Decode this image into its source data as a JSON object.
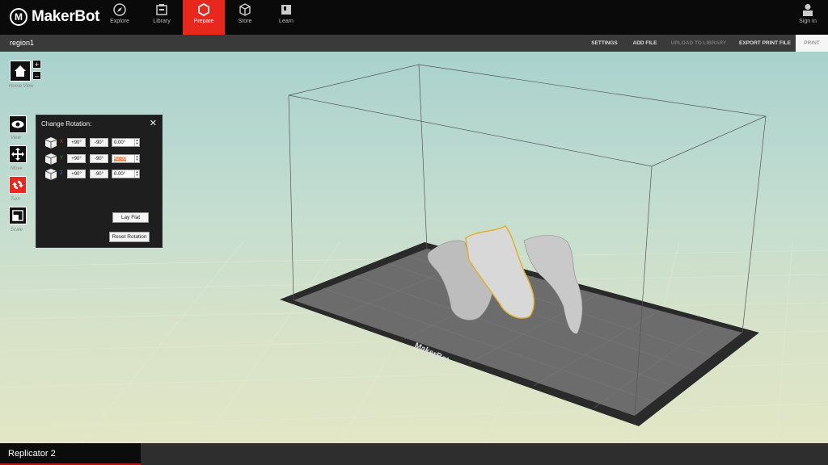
{
  "app": {
    "brand": "MakerBot"
  },
  "nav": {
    "tabs": [
      {
        "label": "Explore",
        "icon": "compass-icon",
        "active": false
      },
      {
        "label": "Library",
        "icon": "library-icon",
        "active": false
      },
      {
        "label": "Prepare",
        "icon": "prepare-cube-icon",
        "active": true
      },
      {
        "label": "Store",
        "icon": "store-cube-icon",
        "active": false
      },
      {
        "label": "Learn",
        "icon": "learn-icon",
        "active": false
      }
    ],
    "signin_label": "Sign In"
  },
  "file": {
    "name": "region1"
  },
  "actions": {
    "settings": "SETTINGS",
    "add_file": "ADD FILE",
    "upload": "UPLOAD TO LIBRARY",
    "export": "EXPORT PRINT FILE",
    "print": "PRINT"
  },
  "tools": {
    "home_view": "Home View",
    "view": "View",
    "move": "Move",
    "turn": "Turn",
    "scale": "Scale",
    "zoom_in": "+",
    "zoom_out": "–",
    "active_tool": "Turn"
  },
  "rotation_panel": {
    "title": "Change Rotation:",
    "close": "✕",
    "rows": [
      {
        "axis": "X",
        "axis_color": "#d23a2a",
        "plus": "+90°",
        "minus": "-90°",
        "value": "0.00°"
      },
      {
        "axis": "Y",
        "axis_color": "#3aa84a",
        "plus": "+90°",
        "minus": "-90°",
        "value": "42.00"
      },
      {
        "axis": "Z",
        "axis_color": "#3a6ad2",
        "plus": "+90°",
        "minus": "-90°",
        "value": "0.00°"
      }
    ],
    "lay_flat": "Lay Flat",
    "reset": "Reset Rotation"
  },
  "build_plate": {
    "logo": "MakerBot"
  },
  "status": {
    "printer": "Replicator 2"
  },
  "colors": {
    "accent": "#e8281c",
    "selection": "#e0b020"
  }
}
